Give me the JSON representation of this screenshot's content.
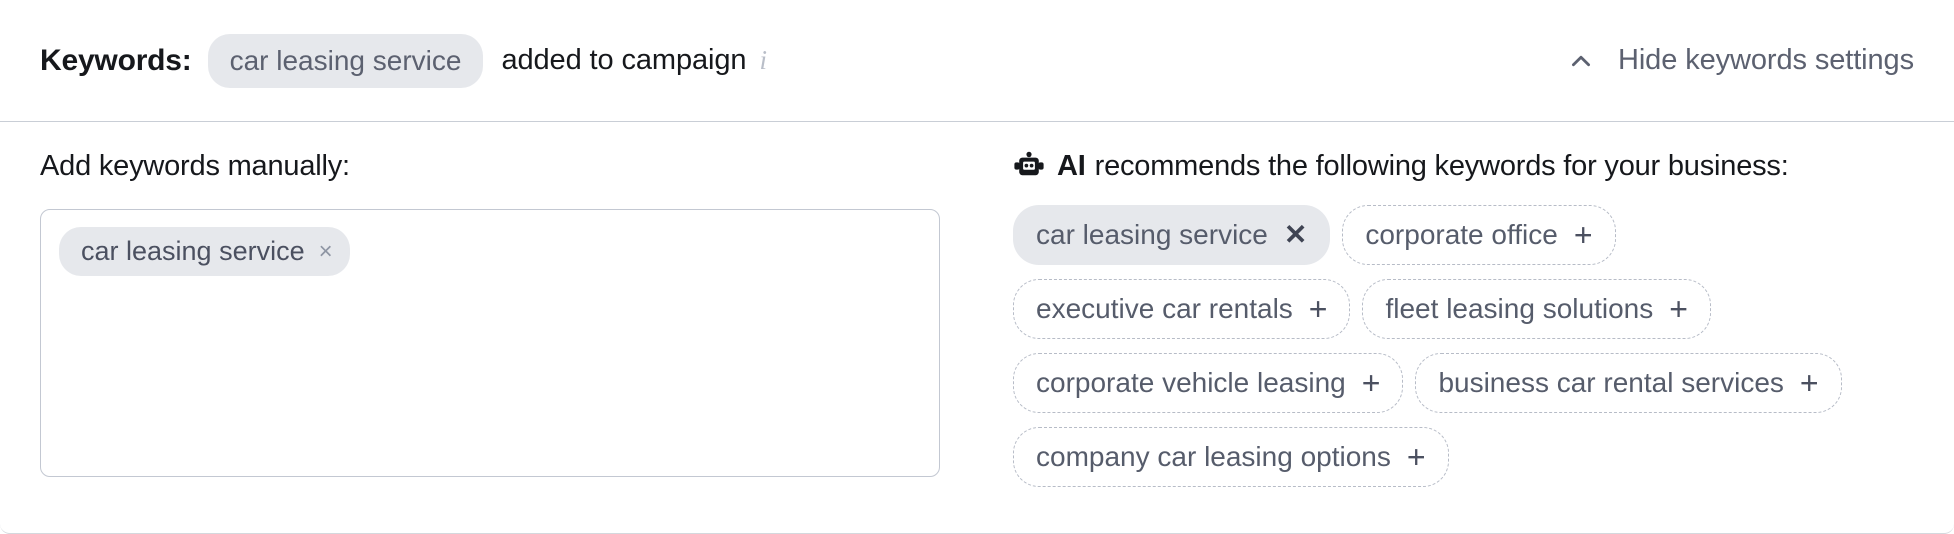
{
  "header": {
    "label": "Keywords:",
    "chip": "car leasing service",
    "added_text": "added to campaign",
    "info_icon": "info-icon",
    "toggle_label": "Hide keywords settings",
    "toggle_icon": "chevron-up-icon"
  },
  "manual": {
    "section_label": "Add keywords manually:",
    "chips": [
      {
        "label": "car leasing service",
        "remove": "×"
      }
    ]
  },
  "ai": {
    "icon": "robot-icon",
    "strong": "AI",
    "rest": "recommends the following keywords for your business:",
    "recommendations": [
      {
        "label": "car leasing service",
        "selected": true,
        "action": "✕"
      },
      {
        "label": "corporate office",
        "selected": false,
        "action": "+"
      },
      {
        "label": "executive car rentals",
        "selected": false,
        "action": "+"
      },
      {
        "label": "fleet leasing solutions",
        "selected": false,
        "action": "+"
      },
      {
        "label": "corporate vehicle leasing",
        "selected": false,
        "action": "+"
      },
      {
        "label": "business car rental services",
        "selected": false,
        "action": "+"
      },
      {
        "label": "company car leasing options",
        "selected": false,
        "action": "+"
      }
    ]
  },
  "colors": {
    "chip_selected_bg": "#e6e8ec",
    "chip_text": "#565c6b",
    "chip_dashed_border": "#b7bcc7",
    "text_primary": "#16181c",
    "divider": "#c9ced6"
  }
}
